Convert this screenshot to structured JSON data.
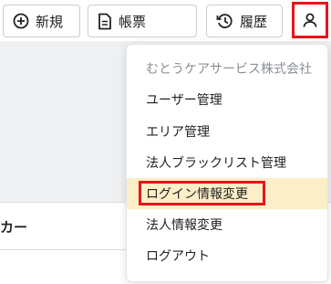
{
  "toolbar": {
    "new_label": "新規",
    "ledger_label": "帳票",
    "history_label": "履歴"
  },
  "section": {
    "label": "カー"
  },
  "menu": {
    "company": "むとうケアサービス株式会社",
    "items": [
      {
        "label": "ユーザー管理"
      },
      {
        "label": "エリア管理"
      },
      {
        "label": "法人ブラックリスト管理"
      },
      {
        "label": "ログイン情報変更"
      },
      {
        "label": "法人情報変更"
      },
      {
        "label": "ログアウト"
      }
    ],
    "active_index": 3
  },
  "colors": {
    "highlight_border": "#e8141b",
    "active_bg": "#fcefc8"
  }
}
